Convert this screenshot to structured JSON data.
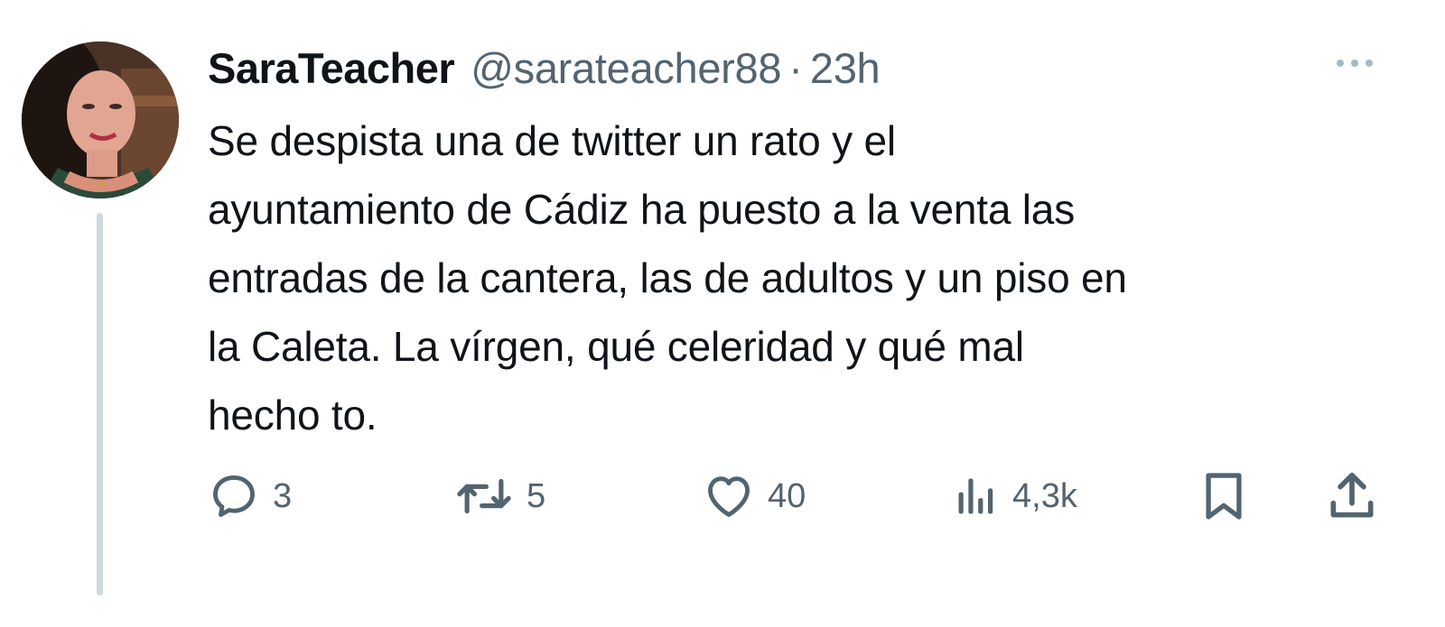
{
  "author": {
    "display_name": "SaraTeacher",
    "handle": "@sarateacher88",
    "separator": "·",
    "time": "23h"
  },
  "tweet": {
    "text_lines": [
      "Se despista una de twitter un rato y el",
      "ayuntamiento de Cádiz ha puesto a la venta las",
      "entradas de la cantera, las de adultos y un piso en",
      "la Caleta. La vírgen, qué celeridad y qué mal",
      "hecho to."
    ]
  },
  "actions": {
    "replies": "3",
    "retweets": "5",
    "likes": "40",
    "views": "4,3k"
  },
  "icons": {
    "reply": "reply-icon",
    "retweet": "retweet-icon",
    "like": "heart-icon",
    "views": "views-icon",
    "bookmark": "bookmark-icon",
    "share": "share-icon",
    "more": "more-icon"
  },
  "colors": {
    "text": "#0f1419",
    "secondary": "#536471",
    "thread_line": "#cfd9de"
  }
}
